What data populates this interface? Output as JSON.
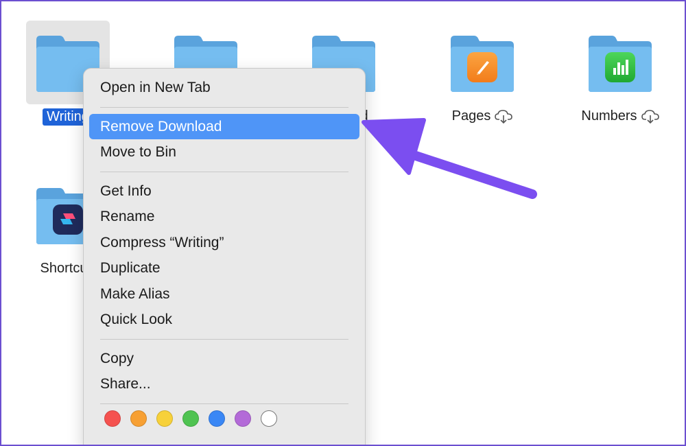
{
  "files": {
    "writing": {
      "label": "Writing"
    },
    "folder2": {
      "label": ""
    },
    "folder3": {
      "label": "d"
    },
    "pages": {
      "label": "Pages"
    },
    "numbers": {
      "label": "Numbers"
    },
    "shortcuts": {
      "label": "Shortcu"
    }
  },
  "context_menu": {
    "open_new_tab": "Open in New Tab",
    "remove_download": "Remove Download",
    "move_to_bin": "Move to Bin",
    "get_info": "Get Info",
    "rename": "Rename",
    "compress": "Compress “Writing”",
    "duplicate": "Duplicate",
    "make_alias": "Make Alias",
    "quick_look": "Quick Look",
    "copy": "Copy",
    "share": "Share...",
    "tags": [
      {
        "name": "red",
        "color": "#f5524f"
      },
      {
        "name": "orange",
        "color": "#f7a033"
      },
      {
        "name": "yellow",
        "color": "#f7d13a"
      },
      {
        "name": "green",
        "color": "#4fc351"
      },
      {
        "name": "blue",
        "color": "#3a87f5"
      },
      {
        "name": "purple",
        "color": "#b36ad8"
      },
      {
        "name": "none",
        "color": "#ffffff"
      }
    ]
  },
  "colors": {
    "selection": "#1f63d8",
    "highlight": "#4f95f7",
    "arrow": "#7b4ef0",
    "folder": "#6cb4ea"
  }
}
